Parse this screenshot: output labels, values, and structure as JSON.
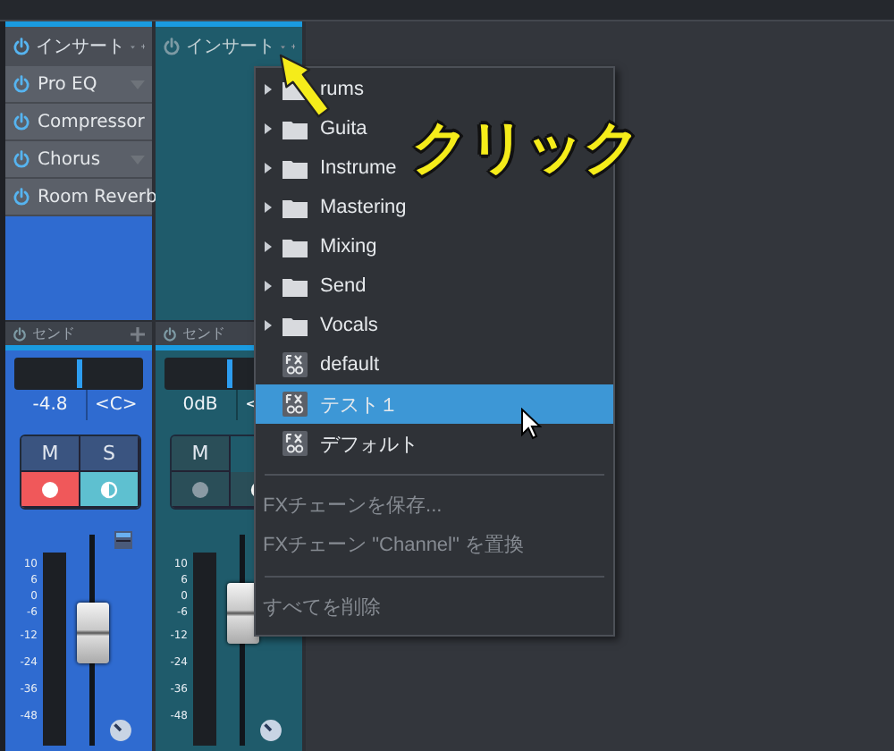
{
  "strips": [
    {
      "color": "#2f6bd0",
      "insert_header": {
        "label": "インサート",
        "on": true
      },
      "inserts": [
        {
          "name": "Pro EQ",
          "on": true
        },
        {
          "name": "Compressor",
          "on": true
        },
        {
          "name": "Chorus",
          "on": true
        },
        {
          "name": "Room Reverb",
          "on": true
        }
      ],
      "send_label": "センド",
      "pan": {
        "level": 0.5
      },
      "volume": "-4.8",
      "pan_reading": "<C>",
      "mute": "M",
      "solo": "S",
      "record_armed": true,
      "monitor_on": true,
      "scale": [
        "10",
        "6",
        "0",
        "-6",
        "-12",
        "-24",
        "-36",
        "-48"
      ],
      "fader": {
        "level": 0.55
      }
    },
    {
      "color": "#1f5b6b",
      "insert_header": {
        "label": "インサート",
        "on": false
      },
      "send_label": "センド",
      "pan": {
        "level": 0.5
      },
      "volume": "0dB",
      "pan_reading": "<",
      "mute": "M",
      "record_armed": false,
      "monitor_on": false,
      "scale": [
        "10",
        "6",
        "0",
        "-6",
        "-12",
        "-24",
        "-36",
        "-48"
      ],
      "fader": {
        "level": 0.68
      }
    }
  ],
  "menu": {
    "items": [
      {
        "kind": "folder",
        "label": "rums",
        "selected": false
      },
      {
        "kind": "folder",
        "label": "Guita",
        "selected": false
      },
      {
        "kind": "folder",
        "label": "Instrume",
        "selected": false
      },
      {
        "kind": "folder",
        "label": "Mastering",
        "selected": false
      },
      {
        "kind": "folder",
        "label": "Mixing",
        "selected": false
      },
      {
        "kind": "folder",
        "label": "Send",
        "selected": false
      },
      {
        "kind": "folder",
        "label": "Vocals",
        "selected": false
      },
      {
        "kind": "preset",
        "label": "default",
        "selected": false
      },
      {
        "kind": "preset",
        "label": "テスト１",
        "selected": true
      },
      {
        "kind": "preset",
        "label": "デフォルト",
        "selected": false
      },
      {
        "kind": "separator"
      },
      {
        "kind": "action",
        "label": "FXチェーンを保存...",
        "disabled": true
      },
      {
        "kind": "action",
        "label": "FXチェーン \"Channel\" を置換",
        "disabled": true
      },
      {
        "kind": "separator"
      },
      {
        "kind": "action",
        "label": "すべてを削除",
        "disabled": true
      }
    ]
  },
  "annotation": {
    "text": "クリック"
  }
}
